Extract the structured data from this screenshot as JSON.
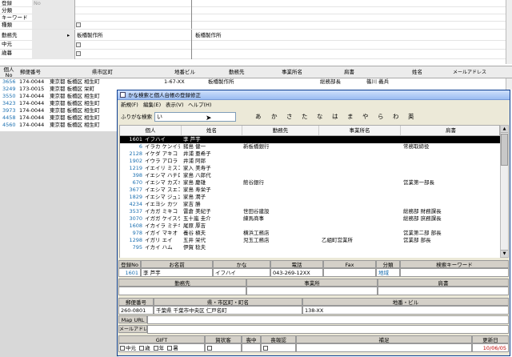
{
  "top_form": {
    "rows": [
      {
        "label": "登録",
        "value": "No",
        "value_color": "#999999"
      },
      {
        "label": "分類",
        "value": ""
      },
      {
        "label": "キーワード",
        "value": ""
      },
      {
        "label": "種類",
        "value": ""
      },
      {
        "label": "勤務先",
        "value": "板橋製作所",
        "right_value": "板橋製作所"
      },
      {
        "label": "中元",
        "value": ""
      },
      {
        "label": "歳暮",
        "value": ""
      }
    ]
  },
  "bg_header": {
    "columns": [
      "個人No",
      "郵便番号",
      "県市区町",
      "地番ビル",
      "勤務先",
      "事業所名",
      "肩書",
      "姓名",
      "メールアドレス"
    ]
  },
  "bg_rows": [
    {
      "no": "3656",
      "zip": "174-0044",
      "addr": "東京都 板橋区 相生町",
      "bldg": "1-67-XX",
      "company": "板橋製作所",
      "office": "",
      "title": "総務部長",
      "name": "篠川 義兵"
    },
    {
      "no": "3249",
      "zip": "173-0015",
      "addr": "東京都 板橋区 栄町"
    },
    {
      "no": "3550",
      "zip": "174-0044",
      "addr": "東京都 板橋区 相生町"
    },
    {
      "no": "3423",
      "zip": "174-0044",
      "addr": "東京都 板橋区 相生町"
    },
    {
      "no": "3973",
      "zip": "174-0044",
      "addr": "東京都 板橋区 相生町"
    },
    {
      "no": "4458",
      "zip": "174-0044",
      "addr": "東京都 板橋区 相生町"
    },
    {
      "no": "4560",
      "zip": "174-0044",
      "addr": "東京都 板橋区 相生町"
    }
  ],
  "dialog": {
    "title": "かな検索と個人台帳の登録修正",
    "menu": [
      "新規(F)",
      "編集(E)",
      "表示(V)",
      "ヘルプ(H)"
    ],
    "search_label": "ふりがな検索",
    "search_value": "い",
    "kana_buttons": [
      "あ",
      "か",
      "さ",
      "た",
      "な",
      "は",
      "ま",
      "や",
      "ら",
      "わ",
      "英"
    ],
    "list_columns": [
      "個人",
      "姓名",
      "勤務先",
      "事業所名",
      "肩書"
    ],
    "rows": [
      {
        "no": "1601",
        "kana": "イフハイ",
        "name": "李 芦芋",
        "company": "",
        "office": "",
        "title": "",
        "selected": true
      },
      {
        "no": "6",
        "kana": "イラカ ケンイチ",
        "name": "猪島 健一",
        "company": "新板橋銀行",
        "office": "",
        "title": "常務取締役"
      },
      {
        "no": "2128",
        "kana": "イケダ アキコ",
        "name": "井浦 亜希子",
        "company": "",
        "office": "",
        "title": ""
      },
      {
        "no": "1902",
        "kana": "イウラ アロラ",
        "name": "井浦 阿郎",
        "company": "",
        "office": "",
        "title": ""
      },
      {
        "no": "1219",
        "kana": "イエイリ ミスコ",
        "name": "家入 美寿子",
        "company": "",
        "office": "",
        "title": ""
      },
      {
        "no": "398",
        "kana": "イエシマ ハチロウ",
        "name": "家島 八郎代",
        "company": "",
        "office": "",
        "title": ""
      },
      {
        "no": "670",
        "kana": "イエシマ カズオ",
        "name": "家島 慶雄",
        "company": "館谷銀行",
        "office": "",
        "title": "営業第一部長"
      },
      {
        "no": "3677",
        "kana": "イエシマ スエコ",
        "name": "家島 寿栄子",
        "company": "",
        "office": "",
        "title": ""
      },
      {
        "no": "1829",
        "kana": "イエシマ ジュンコ",
        "name": "家島 潤子",
        "company": "",
        "office": "",
        "title": ""
      },
      {
        "no": "4234",
        "kana": "イエヨシ カツ",
        "name": "家吉 勝",
        "company": "",
        "office": "",
        "title": ""
      },
      {
        "no": "3537",
        "kana": "イカガ ミキコ",
        "name": "雷倉 美紀子",
        "company": "世田谷建設",
        "office": "",
        "title": "総務部 財務課長"
      },
      {
        "no": "3070",
        "kana": "イガガ ケイスケ",
        "name": "五十嵐 圭介",
        "company": "練馬商事",
        "office": "",
        "title": "総務部 庶務課長"
      },
      {
        "no": "1608",
        "kana": "イカイラ ミチキチ",
        "name": "尾原 厚吉",
        "company": "",
        "office": "",
        "title": ""
      },
      {
        "no": "978",
        "kana": "イガイ マキオ",
        "name": "養谷 槇夫",
        "company": "横浜工務店",
        "office": "",
        "title": "営業第二部 部長"
      },
      {
        "no": "1298",
        "kana": "イガリ エイ",
        "name": "五井 栄代",
        "company": "児玉工務店",
        "office": "乙組町営業所",
        "title": "営業部 部長"
      },
      {
        "no": "795",
        "kana": "イカイ ハム",
        "name": "伊賀 稔夫",
        "company": "",
        "office": "",
        "title": ""
      }
    ],
    "detail": {
      "h_no": "登録No",
      "h_name": "お名前",
      "h_kana": "かな",
      "h_tel": "電話",
      "h_fax": "Fax",
      "h_cat": "分類",
      "h_kw": "検索キーワード",
      "v_no": "1601",
      "v_name": "李 芦芋",
      "v_kana": "イフハイ",
      "v_tel": "043-269-12XX",
      "v_fax": "",
      "v_cat": "地域",
      "v_kw": "",
      "h_company": "勤務先",
      "h_office": "事業所",
      "h_title": "肩書",
      "h_zip": "郵便番号",
      "h_addr": "県・市区町・町名",
      "h_bldg": "地番・ビル",
      "v_zip": "260-0801",
      "v_addr": "千葉県 千葉市中央区 仁戸名町",
      "v_bldg": "138-XX",
      "map_label": "Map URL",
      "mail_label": "メールアドレス",
      "h_gift": "GIFT",
      "h_greet": "賀状客",
      "h_mourn": "喪中",
      "h_omit": "喪報認",
      "h_note": "補足",
      "h_updated": "更新日",
      "checks": [
        "中元",
        "歳",
        "年",
        "暑"
      ],
      "updated": "10/06/05"
    }
  }
}
